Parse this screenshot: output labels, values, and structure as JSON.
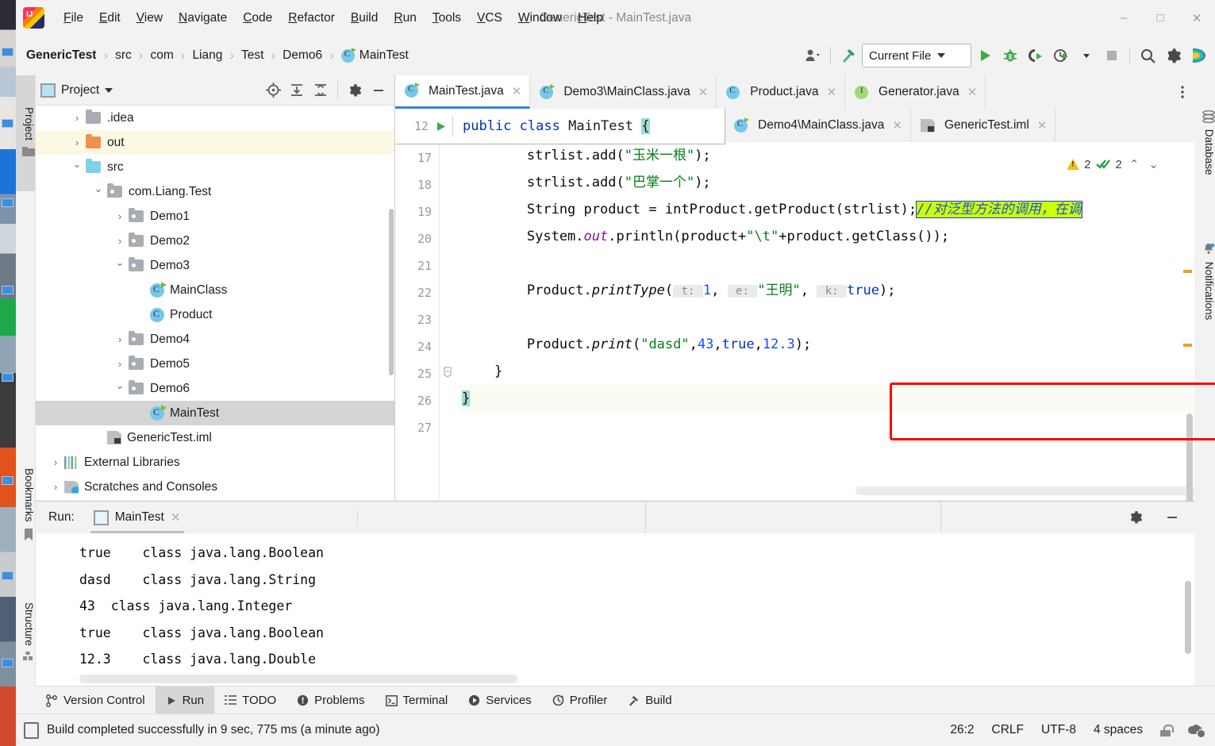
{
  "window": {
    "title": "GenericTest - MainTest.java",
    "minimize": "–",
    "maximize": "□",
    "close": "✕"
  },
  "menubar": {
    "items": [
      "File",
      "Edit",
      "View",
      "Navigate",
      "Code",
      "Refactor",
      "Build",
      "Run",
      "Tools",
      "VCS",
      "Window",
      "Help"
    ]
  },
  "breadcrumb": {
    "items": [
      "GenericTest",
      "src",
      "com",
      "Liang",
      "Test",
      "Demo6",
      "MainTest"
    ],
    "separator": "›",
    "last_icon": "java-class-icon"
  },
  "toolbar": {
    "profile_icon": "user-profile-icon",
    "build_icon": "hammer-icon",
    "run_config": "Current File",
    "run_icon": "run-play-icon",
    "debug_icon": "debug-bug-icon",
    "run_coverage_icon": "run-with-coverage-icon",
    "profiler_icon": "profiler-clock-icon",
    "stop_icon": "stop-square-icon",
    "search_icon": "search-icon",
    "settings_icon": "gear-icon",
    "ai_icon": "ai-assistant-icon"
  },
  "left_strip": {
    "tabs": [
      {
        "label": "Project",
        "icon": "folder-icon",
        "active": true
      },
      {
        "label": "Bookmarks",
        "icon": "bookmark-icon",
        "active": false
      },
      {
        "label": "Structure",
        "icon": "structure-icon",
        "active": false
      }
    ]
  },
  "right_strip": {
    "tabs": [
      {
        "label": "Database",
        "icon": "database-icon"
      },
      {
        "label": "Notifications",
        "icon": "bell-icon"
      }
    ]
  },
  "project_panel": {
    "title": "Project",
    "dropdown_icon": "chevron-down-icon",
    "actions": [
      "locate-icon",
      "expand-all-icon",
      "collapse-all-icon",
      "gear-icon",
      "hide-icon"
    ],
    "tree": [
      {
        "label": ".idea",
        "indent": 1,
        "arrow": "closed",
        "icon": "folder-gray",
        "state": "normal"
      },
      {
        "label": "out",
        "indent": 1,
        "arrow": "closed",
        "icon": "folder-orange",
        "state": "highlight"
      },
      {
        "label": "src",
        "indent": 1,
        "arrow": "open",
        "icon": "folder-blue",
        "state": "normal"
      },
      {
        "label": "com.Liang.Test",
        "indent": 2,
        "arrow": "open",
        "icon": "package",
        "state": "normal"
      },
      {
        "label": "Demo1",
        "indent": 3,
        "arrow": "closed",
        "icon": "package",
        "state": "normal"
      },
      {
        "label": "Demo2",
        "indent": 3,
        "arrow": "closed",
        "icon": "package",
        "state": "normal"
      },
      {
        "label": "Demo3",
        "indent": 3,
        "arrow": "open",
        "icon": "package",
        "state": "normal"
      },
      {
        "label": "MainClass",
        "indent": 4,
        "arrow": "none",
        "icon": "class-runnable",
        "state": "normal"
      },
      {
        "label": "Product",
        "indent": 4,
        "arrow": "none",
        "icon": "class",
        "state": "normal"
      },
      {
        "label": "Demo4",
        "indent": 3,
        "arrow": "closed",
        "icon": "package",
        "state": "normal"
      },
      {
        "label": "Demo5",
        "indent": 3,
        "arrow": "closed",
        "icon": "package",
        "state": "normal"
      },
      {
        "label": "Demo6",
        "indent": 3,
        "arrow": "open",
        "icon": "package",
        "state": "normal"
      },
      {
        "label": "MainTest",
        "indent": 4,
        "arrow": "none",
        "icon": "class-runnable",
        "state": "selected"
      },
      {
        "label": "GenericTest.iml",
        "indent": 2,
        "arrow": "none",
        "icon": "iml",
        "state": "normal"
      },
      {
        "label": "External Libraries",
        "indent": 0,
        "arrow": "closed",
        "icon": "library",
        "state": "normal"
      },
      {
        "label": "Scratches and Consoles",
        "indent": 0,
        "arrow": "closed",
        "icon": "scratch",
        "state": "normal"
      }
    ]
  },
  "editor": {
    "tabs_row1": [
      {
        "label": "MainTest.java",
        "icon": "java-class-runnable-icon",
        "active": true
      },
      {
        "label": "Demo3\\MainClass.java",
        "icon": "java-class-runnable-icon",
        "active": false
      },
      {
        "label": "Product.java",
        "icon": "java-class-icon",
        "active": false
      },
      {
        "label": "Generator.java",
        "icon": "java-interface-icon",
        "active": false
      }
    ],
    "tabs_row2": [
      {
        "label": "Demo4\\MainClass.java",
        "icon": "java-class-runnable-icon",
        "active": false
      },
      {
        "label": "GenericTest.iml",
        "icon": "iml-file-icon",
        "active": false
      }
    ],
    "tab_overflow_icon": "more-vertical-icon",
    "close_icon": "✕",
    "sticky_line": {
      "line_number": "12",
      "run_icon": "gutter-run-icon",
      "text_kw1": "public",
      "text_kw2": "class",
      "text_name": "MainTest",
      "text_brace": "{"
    },
    "inspections": {
      "warning_count": "2",
      "ok_count": "2",
      "up_icon": "⌃",
      "down_icon": "⌄",
      "warning_icon": "warning-triangle-icon",
      "ok_icon": "double-check-icon"
    },
    "line_numbers": [
      "17",
      "18",
      "19",
      "20",
      "21",
      "22",
      "23",
      "24",
      "25",
      "26",
      "27"
    ],
    "lines": [
      {
        "n": "17",
        "segments": [
          {
            "t": "        strlist.add(",
            "c": "plain"
          },
          {
            "t": "\"玉米一根\"",
            "c": "str"
          },
          {
            "t": ");",
            "c": "plain"
          }
        ]
      },
      {
        "n": "18",
        "segments": [
          {
            "t": "        strlist.add(",
            "c": "plain"
          },
          {
            "t": "\"巴掌一个\"",
            "c": "str"
          },
          {
            "t": ");",
            "c": "plain"
          }
        ]
      },
      {
        "n": "19",
        "segments": [
          {
            "t": "        String product = intProduct.getProduct(strlist);",
            "c": "plain"
          },
          {
            "t": "//对泛型方法的调用，在调",
            "c": "cmt-hl"
          }
        ]
      },
      {
        "n": "20",
        "segments": [
          {
            "t": "        System.",
            "c": "plain"
          },
          {
            "t": "out",
            "c": "fld"
          },
          {
            "t": ".println(product+",
            "c": "plain"
          },
          {
            "t": "\"\\t\"",
            "c": "str"
          },
          {
            "t": "+product.getClass());",
            "c": "plain"
          }
        ]
      },
      {
        "n": "21",
        "segments": [
          {
            "t": "",
            "c": "plain"
          }
        ]
      },
      {
        "n": "22",
        "segments": [
          {
            "t": "        Product.",
            "c": "plain"
          },
          {
            "t": "printType",
            "c": "mth"
          },
          {
            "t": "(",
            "c": "plain"
          },
          {
            "t": " t: ",
            "c": "hint"
          },
          {
            "t": "1",
            "c": "num"
          },
          {
            "t": ", ",
            "c": "plain"
          },
          {
            "t": " e: ",
            "c": "hint"
          },
          {
            "t": "\"王明\"",
            "c": "str"
          },
          {
            "t": ", ",
            "c": "plain"
          },
          {
            "t": " k: ",
            "c": "hint"
          },
          {
            "t": "true",
            "c": "kw"
          },
          {
            "t": ");",
            "c": "plain"
          }
        ]
      },
      {
        "n": "23",
        "segments": [
          {
            "t": "",
            "c": "plain"
          }
        ]
      },
      {
        "n": "24",
        "segments": [
          {
            "t": "        Product.",
            "c": "plain"
          },
          {
            "t": "print",
            "c": "mth"
          },
          {
            "t": "(",
            "c": "plain"
          },
          {
            "t": "\"dasd\"",
            "c": "str"
          },
          {
            "t": ",",
            "c": "plain"
          },
          {
            "t": "43",
            "c": "num"
          },
          {
            "t": ",",
            "c": "plain"
          },
          {
            "t": "true",
            "c": "kw"
          },
          {
            "t": ",",
            "c": "plain"
          },
          {
            "t": "12.3",
            "c": "num"
          },
          {
            "t": ");",
            "c": "plain"
          }
        ]
      },
      {
        "n": "25",
        "segments": [
          {
            "t": "    }",
            "c": "plain"
          }
        ]
      },
      {
        "n": "26",
        "segments": [
          {
            "t": "}",
            "c": "caret"
          }
        ]
      },
      {
        "n": "27",
        "segments": [
          {
            "t": "",
            "c": "plain"
          }
        ]
      }
    ],
    "annotation": {
      "name": "red-highlight-box"
    }
  },
  "run_window": {
    "label": "Run:",
    "tab": "MainTest",
    "tab_icon": "console-icon",
    "close_icon": "✕",
    "settings_icon": "gear-icon",
    "hide_icon": "–",
    "console_lines": [
      "true    class java.lang.Boolean",
      "dasd    class java.lang.String",
      "43  class java.lang.Integer",
      "true    class java.lang.Boolean",
      "12.3    class java.lang.Double"
    ]
  },
  "bottom_bar": {
    "tabs": [
      {
        "label": "Version Control",
        "icon": "branch-icon",
        "active": false
      },
      {
        "label": "Run",
        "icon": "run-play-icon",
        "active": true
      },
      {
        "label": "TODO",
        "icon": "list-icon",
        "active": false
      },
      {
        "label": "Problems",
        "icon": "error-icon",
        "active": false
      },
      {
        "label": "Terminal",
        "icon": "terminal-icon",
        "active": false
      },
      {
        "label": "Services",
        "icon": "services-icon",
        "active": false
      },
      {
        "label": "Profiler",
        "icon": "profiler-icon",
        "active": false
      },
      {
        "label": "Build",
        "icon": "hammer-icon",
        "active": false
      }
    ]
  },
  "status_bar": {
    "message": "Build completed successfully in 9 sec, 775 ms (a minute ago)",
    "message_icon": "build-status-icon",
    "caret_position": "26:2",
    "line_separator": "CRLF",
    "encoding": "UTF-8",
    "indent": "4 spaces",
    "lock_icon": "unlocked-icon",
    "cloud_icon": "cloud-settings-icon"
  },
  "colors": {
    "accent_blue": "#3a86d6",
    "keyword": "#0033b3",
    "string": "#067d17",
    "number": "#1750eb",
    "field": "#871094",
    "comment_highlight": "#ccff00",
    "red_box": "#fe0000",
    "selected_row": "#d4d4d4",
    "highlight_row": "#fdf8e3"
  }
}
